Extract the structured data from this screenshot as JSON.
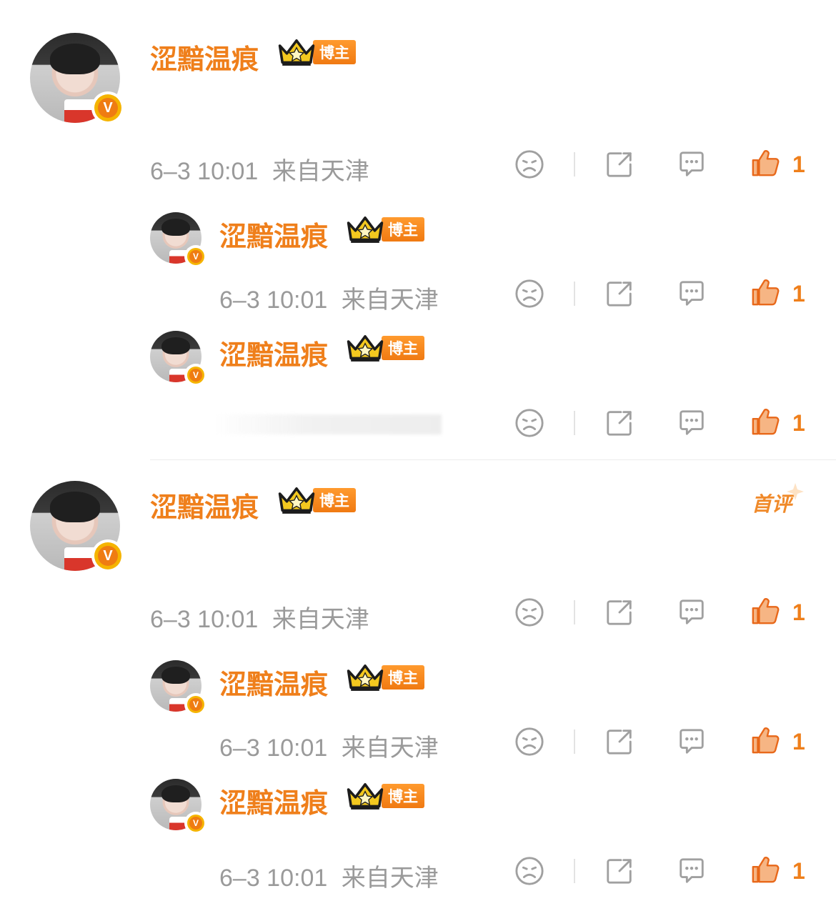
{
  "user": {
    "name": "涩黯温痕",
    "badge_label": "博主",
    "verified_mark": "V"
  },
  "colors": {
    "accent": "#ef7f1b",
    "meta_gray": "#9a9a9a",
    "icon_gray": "#a0a0a0"
  },
  "first_comment_label": "首评",
  "comments": [
    {
      "time": "6–3 10:01",
      "location": "来自天津",
      "likes": "1"
    },
    {
      "time": "6–3 10:01",
      "location": "来自天津",
      "likes": "1"
    },
    {
      "time": "",
      "location": "",
      "likes": "1"
    },
    {
      "time": "6–3 10:01",
      "location": "来自天津",
      "likes": "1"
    },
    {
      "time": "6–3 10:01",
      "location": "来自天津",
      "likes": "1"
    },
    {
      "time": "6–3 10:01",
      "location": "来自天津",
      "likes": "1"
    }
  ],
  "icons": {
    "dislike": "sad-face-icon",
    "share": "share-icon",
    "reply": "comment-icon",
    "like": "thumbs-up-icon",
    "crown": "crown-icon"
  }
}
